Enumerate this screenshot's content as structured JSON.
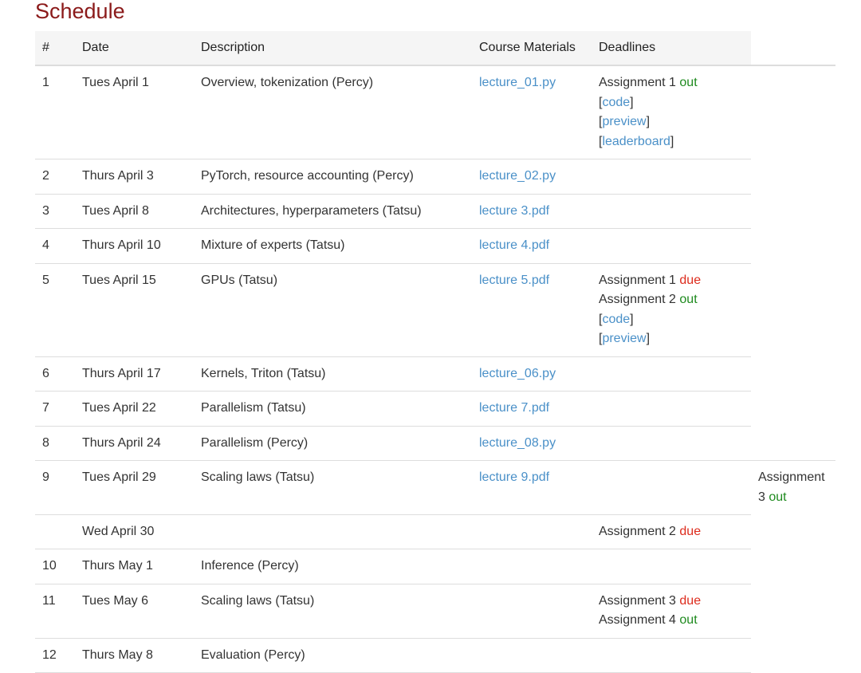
{
  "page": {
    "title": "Schedule",
    "colors": {
      "title": "#8b1a1a",
      "link": "#4a90c8",
      "out": "#1e8a1e",
      "due": "#dd2b1c"
    }
  },
  "table": {
    "headers": [
      "#",
      "Date",
      "Description",
      "Course Materials",
      "Deadlines"
    ],
    "rows": [
      {
        "num": "1",
        "date": "Tues April 1",
        "desc": "Overview, tokenization (Percy)",
        "material": "lecture_01.py",
        "deadlines": [
          {
            "text": "Assignment 1 ",
            "status": "out"
          },
          {
            "link": "code"
          },
          {
            "link": "preview"
          },
          {
            "link": "leaderboard"
          }
        ]
      },
      {
        "num": "2",
        "date": "Thurs April 3",
        "desc": "PyTorch, resource accounting (Percy)",
        "material": "lecture_02.py",
        "deadlines": []
      },
      {
        "num": "3",
        "date": "Tues April 8",
        "desc": "Architectures, hyperparameters (Tatsu)",
        "material": "lecture 3.pdf",
        "deadlines": []
      },
      {
        "num": "4",
        "date": "Thurs April 10",
        "desc": "Mixture of experts (Tatsu)",
        "material": "lecture 4.pdf",
        "deadlines": []
      },
      {
        "num": "5",
        "date": "Tues April 15",
        "desc": "GPUs (Tatsu)",
        "material": "lecture 5.pdf",
        "deadlines": [
          {
            "text": "Assignment 1 ",
            "status": "due"
          },
          {
            "text": "Assignment 2 ",
            "status": "out"
          },
          {
            "link": "code"
          },
          {
            "link": "preview"
          }
        ]
      },
      {
        "num": "6",
        "date": "Thurs April 17",
        "desc": "Kernels, Triton (Tatsu)",
        "material": "lecture_06.py",
        "deadlines": []
      },
      {
        "num": "7",
        "date": "Tues April 22",
        "desc": "Parallelism (Tatsu)",
        "material": "lecture 7.pdf",
        "deadlines": []
      },
      {
        "num": "8",
        "date": "Thurs April 24",
        "desc": "Parallelism (Percy)",
        "material": "lecture_08.py",
        "deadlines": []
      },
      {
        "num": "9",
        "date": "Tues April 29",
        "desc": "Scaling laws (Tatsu)",
        "material": "lecture 9.pdf",
        "deadlines": [],
        "extra": [
          {
            "text": "Assignment",
            "status": ""
          },
          {
            "text": "3 ",
            "status": "out"
          }
        ]
      },
      {
        "num": "",
        "date": "Wed April 30",
        "desc": "",
        "material": "",
        "deadlines": [
          {
            "text": "Assignment 2 ",
            "status": "due"
          }
        ]
      },
      {
        "num": "10",
        "date": "Thurs May 1",
        "desc": "Inference (Percy)",
        "material": "",
        "deadlines": []
      },
      {
        "num": "11",
        "date": "Tues May 6",
        "desc": "Scaling laws (Tatsu)",
        "material": "",
        "deadlines": [
          {
            "text": "Assignment 3 ",
            "status": "due"
          },
          {
            "text": "Assignment 4 ",
            "status": "out"
          }
        ]
      },
      {
        "num": "12",
        "date": "Thurs May 8",
        "desc": "Evaluation (Percy)",
        "material": "",
        "deadlines": []
      }
    ]
  }
}
